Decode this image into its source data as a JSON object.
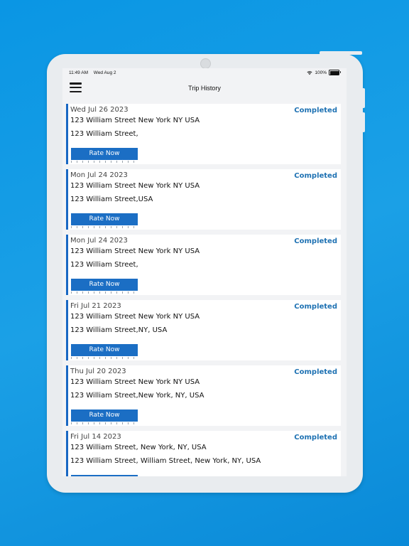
{
  "status_bar": {
    "time": "11:49 AM",
    "date": "Wed Aug 2",
    "battery": "100%"
  },
  "nav": {
    "title": "Trip History",
    "menu_icon": "hamburger-menu-icon"
  },
  "colors": {
    "background": "#0a96e4",
    "accent": "#1b6ec4",
    "status": "#1f72b3"
  },
  "trips": [
    {
      "date": "Wed Jul 26 2023",
      "status": "Completed",
      "line1": "123 William Street New York NY USA",
      "line2": "123 William Street,",
      "button": "Rate Now"
    },
    {
      "date": "Mon Jul 24 2023",
      "status": "Completed",
      "line1": "123 William Street New York NY USA",
      "line2": "123 William Street,USA",
      "button": "Rate Now"
    },
    {
      "date": "Mon Jul 24 2023",
      "status": "Completed",
      "line1": "123 William Street New York NY USA",
      "line2": "123 William Street,",
      "button": "Rate Now"
    },
    {
      "date": "Fri Jul 21 2023",
      "status": "Completed",
      "line1": "123 William Street New York NY USA",
      "line2": "123 William Street,NY, USA",
      "button": "Rate Now"
    },
    {
      "date": "Thu Jul 20 2023",
      "status": "Completed",
      "line1": "123 William Street New York NY USA",
      "line2": "123 William Street,New York, NY, USA",
      "button": "Rate Now"
    },
    {
      "date": "Fri Jul 14 2023",
      "status": "Completed",
      "line1": "123 William Street, New York, NY, USA",
      "line2": "123 William Street, William Street, New York, NY, USA",
      "button": ""
    }
  ]
}
